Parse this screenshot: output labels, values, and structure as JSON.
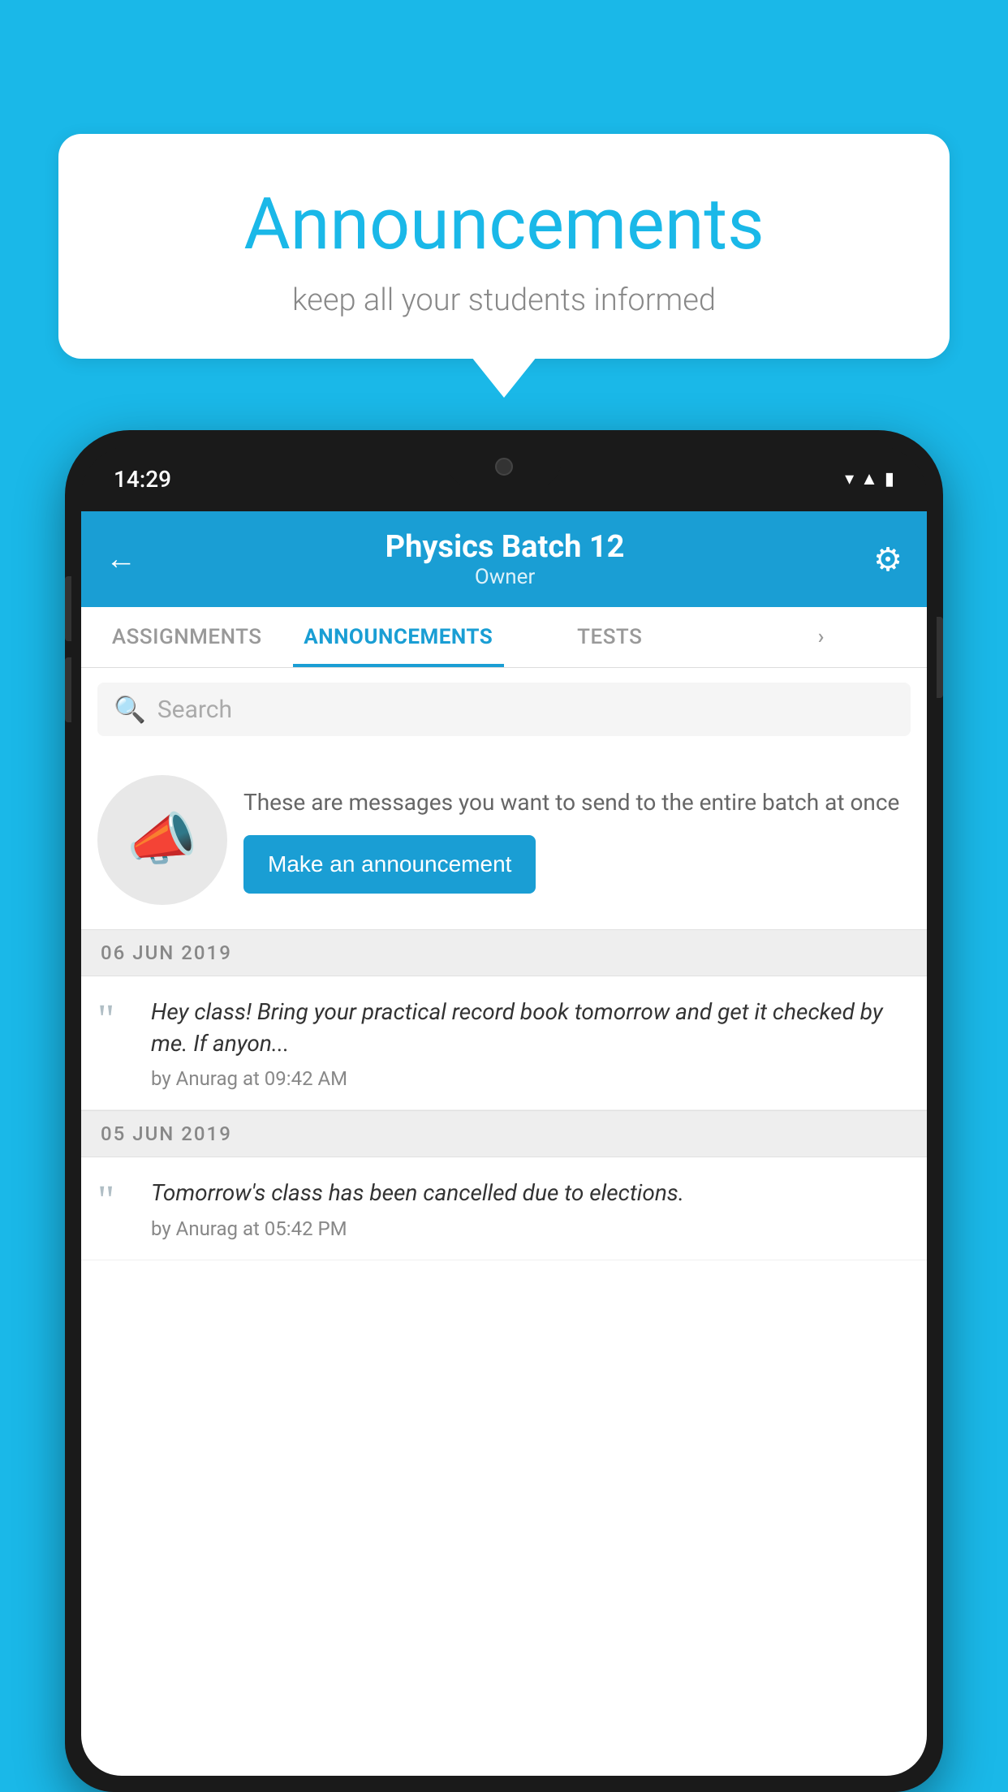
{
  "background_color": "#1ab8e8",
  "speech_bubble": {
    "title": "Announcements",
    "subtitle": "keep all your students informed"
  },
  "phone": {
    "status_bar": {
      "time": "14:29",
      "wifi": "▾",
      "signal": "▲",
      "battery": "▮"
    },
    "header": {
      "back_label": "←",
      "title": "Physics Batch 12",
      "subtitle": "Owner",
      "settings_label": "⚙"
    },
    "tabs": [
      {
        "label": "ASSIGNMENTS",
        "active": false
      },
      {
        "label": "ANNOUNCEMENTS",
        "active": true
      },
      {
        "label": "TESTS",
        "active": false
      },
      {
        "label": "›",
        "active": false
      }
    ],
    "search": {
      "placeholder": "Search"
    },
    "promo": {
      "description": "These are messages you want to send to the entire batch at once",
      "button_label": "Make an announcement"
    },
    "announcements": [
      {
        "date": "06  JUN  2019",
        "text": "Hey class! Bring your practical record book tomorrow and get it checked by me. If anyon...",
        "meta": "by Anurag at 09:42 AM"
      },
      {
        "date": "05  JUN  2019",
        "text": "Tomorrow's class has been cancelled due to elections.",
        "meta": "by Anurag at 05:42 PM"
      }
    ]
  }
}
